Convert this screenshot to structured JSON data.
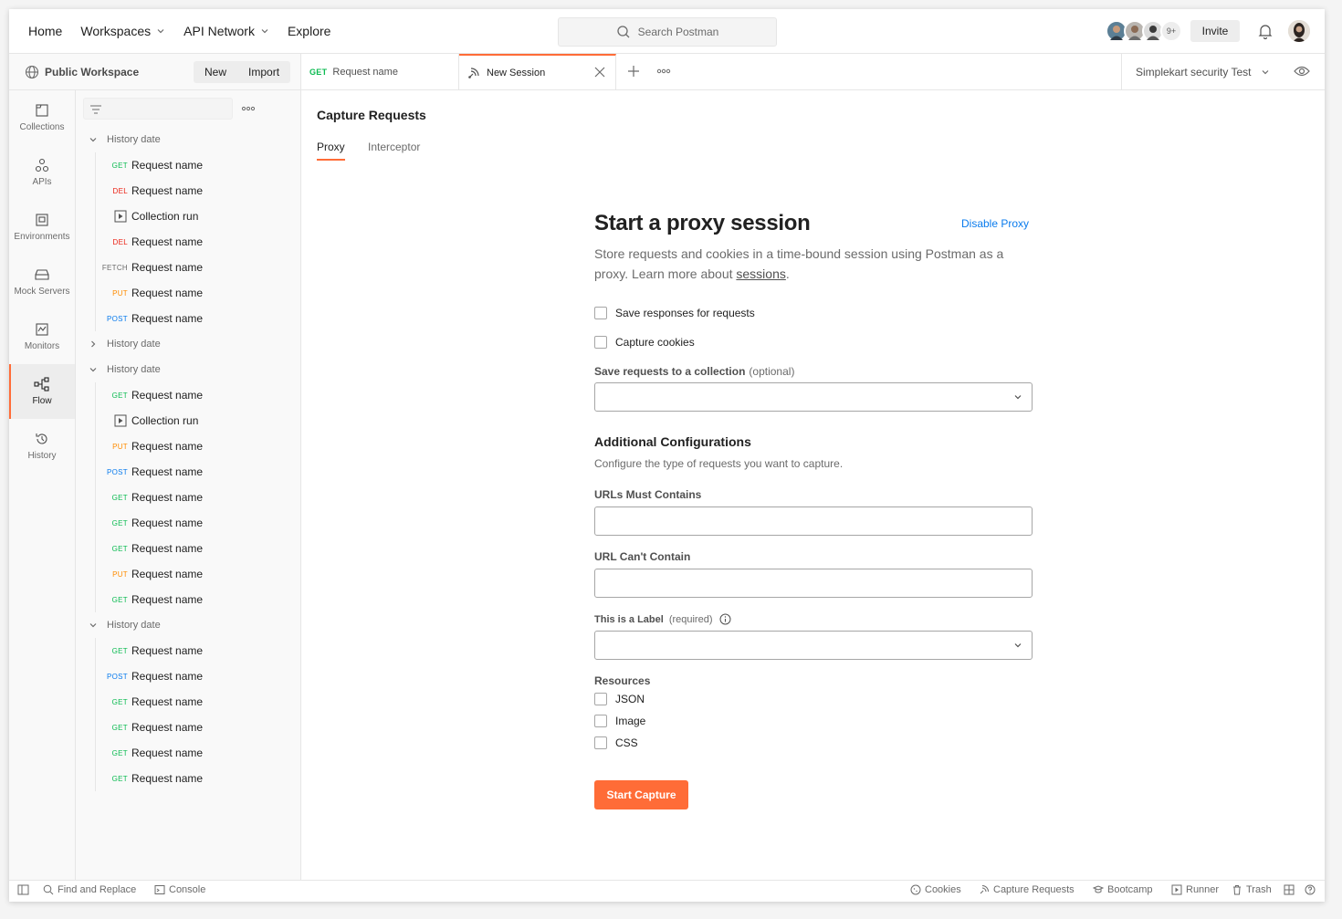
{
  "topnav": {
    "home": "Home",
    "workspaces": "Workspaces",
    "api_network": "API Network",
    "explore": "Explore"
  },
  "search": {
    "placeholder": "Search Postman"
  },
  "collaborators": {
    "overflow_count": "9+"
  },
  "invite_label": "Invite",
  "workspace": {
    "name": "Public Workspace",
    "new_label": "New",
    "import_label": "Import"
  },
  "tabs": [
    {
      "method": "GET",
      "label": "Request name"
    },
    {
      "label": "New Session"
    }
  ],
  "environment": "Simplekart security Test",
  "iconbar": [
    {
      "label": "Collections",
      "icon": "collections-icon"
    },
    {
      "label": "APIs",
      "icon": "apis-icon"
    },
    {
      "label": "Environments",
      "icon": "environments-icon"
    },
    {
      "label": "Mock Servers",
      "icon": "mock-servers-icon"
    },
    {
      "label": "Monitors",
      "icon": "monitors-icon"
    },
    {
      "label": "Flow",
      "icon": "flow-icon",
      "active": true
    },
    {
      "label": "History",
      "icon": "history-icon"
    }
  ],
  "history": {
    "groups": [
      {
        "label": "History date",
        "expanded": true,
        "items": [
          {
            "method": "GET",
            "label": "Request name"
          },
          {
            "method": "DEL",
            "label": "Request name"
          },
          {
            "method": "RUN",
            "label": "Collection run"
          },
          {
            "method": "DEL",
            "label": "Request name"
          },
          {
            "method": "FETCH",
            "label": "Request name"
          },
          {
            "method": "PUT",
            "label": "Request name"
          },
          {
            "method": "POST",
            "label": "Request name"
          }
        ]
      },
      {
        "label": "History date",
        "expanded": false,
        "items": []
      },
      {
        "label": "History date",
        "expanded": true,
        "items": [
          {
            "method": "GET",
            "label": "Request name"
          },
          {
            "method": "RUN",
            "label": "Collection run"
          },
          {
            "method": "PUT",
            "label": "Request name"
          },
          {
            "method": "POST",
            "label": "Request name"
          },
          {
            "method": "GET",
            "label": "Request name"
          },
          {
            "method": "GET",
            "label": "Request name"
          },
          {
            "method": "GET",
            "label": "Request name"
          },
          {
            "method": "PUT",
            "label": "Request name"
          },
          {
            "method": "GET",
            "label": "Request name"
          }
        ]
      },
      {
        "label": "History date",
        "expanded": true,
        "items": [
          {
            "method": "GET",
            "label": "Request name"
          },
          {
            "method": "POST",
            "label": "Request name"
          },
          {
            "method": "GET",
            "label": "Request name"
          },
          {
            "method": "GET",
            "label": "Request name"
          },
          {
            "method": "GET",
            "label": "Request name"
          },
          {
            "method": "GET",
            "label": "Request name"
          }
        ]
      }
    ]
  },
  "main": {
    "title": "Capture Requests",
    "subtabs": {
      "proxy": "Proxy",
      "interceptor": "Interceptor"
    },
    "heading": "Start a proxy session",
    "disable_proxy": "Disable Proxy",
    "description": "Store requests and cookies in a time-bound session using Postman as a proxy. Learn more about ",
    "description_link": "sessions",
    "description_end": ".",
    "save_responses": "Save responses for requests",
    "capture_cookies": "Capture cookies",
    "save_to_collection_label": "Save requests to a collection",
    "save_to_collection_optional": "(optional)",
    "additional_title": "Additional Configurations",
    "additional_desc": "Configure the type of requests you want to capture.",
    "urls_must_contain": "URLs Must Contains",
    "url_cant_contain": "URL Can't Contain",
    "label_field": "This is a Label",
    "label_required": "(required)",
    "resources_label": "Resources",
    "resources": [
      "JSON",
      "Image",
      "CSS"
    ],
    "start_button": "Start Capture"
  },
  "statusbar": {
    "find_replace": "Find and Replace",
    "console": "Console",
    "cookies": "Cookies",
    "capture_requests": "Capture Requests",
    "bootcamp": "Bootcamp",
    "runner": "Runner",
    "trash": "Trash"
  },
  "colors": {
    "accent": "#ff6c37",
    "link": "#097bed",
    "get": "#0cbb52",
    "del": "#eb2013",
    "put": "#ff8c00",
    "post": "#097bed"
  }
}
